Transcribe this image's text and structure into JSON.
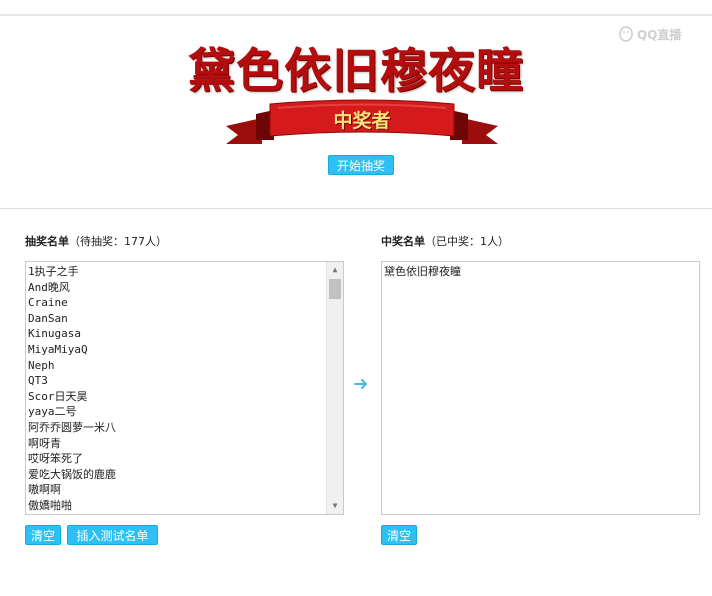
{
  "watermark": {
    "text": "QQ直播",
    "icon": "qq-penguin-icon"
  },
  "hero": {
    "title": "黛色依旧穆夜瞳",
    "ribbon_label": "中奖者"
  },
  "controls": {
    "start_label": "开始抽奖"
  },
  "pool": {
    "title": "抽奖名单",
    "count_text": "（待抽奖：177人）",
    "items": [
      "1执子之手",
      "And晚风",
      "Craine",
      "DanSan",
      "Kinugasa",
      "MiyaMiyaQ",
      "Neph",
      "QT3",
      "Scor日天昊",
      "yaya二号",
      "阿乔乔圆萝一米八",
      "啊呀青",
      "哎呀笨死了",
      "爱吃大锅饭的鹿鹿",
      "嗷啊啊",
      "傲嬌啪啪"
    ],
    "clear_label": "清空",
    "insert_label": "插入测试名单"
  },
  "transfer_icon": "arrow-right-icon",
  "winners": {
    "title": "中奖名单",
    "count_text": "（已中奖：1人）",
    "items": [
      "黛色依旧穆夜瞳"
    ],
    "clear_label": "清空"
  },
  "colors": {
    "accent": "#2cc0f4",
    "title_red": "#b40d0d",
    "ribbon_red": "#d41a1a",
    "ribbon_text": "#ffe37a"
  }
}
